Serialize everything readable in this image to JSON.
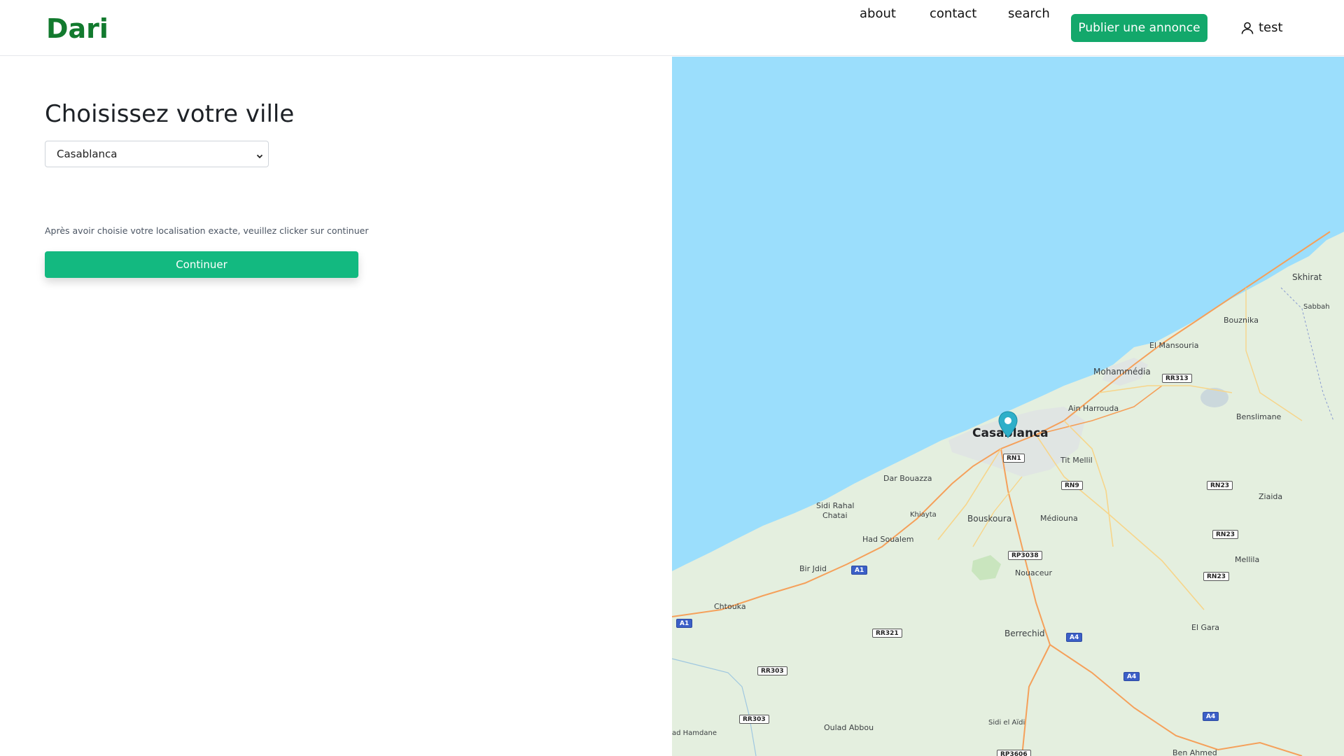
{
  "header": {
    "logo": "Dari",
    "nav": {
      "about": "about",
      "contact": "contact",
      "search": "search"
    },
    "publish_label": "Publier une annonce",
    "user_label": "test"
  },
  "main": {
    "title": "Choisissez votre ville",
    "city_select": {
      "selected": "Casablanca"
    },
    "hint": "Après avoir choisie votre localisation exacte, veuillez clicker sur continuer",
    "continue_label": "Continuer"
  },
  "map": {
    "colors": {
      "water": "#9bdefc",
      "land": "#e4efdf",
      "road_major": "#f5a05a",
      "road_minor": "#f7d58a",
      "urban": "#dfe3e3",
      "marker": "#2eafc9"
    },
    "marker_icon": "map-pin-icon",
    "labels": {
      "casablanca": "Casablanca",
      "skhirat": "Skhirat",
      "sabbah": "Sabbah",
      "bouznika": "Bouznika",
      "el_mansouria": "El Mansouria",
      "mohammedia": "Mohammédia",
      "ain_harrouda": "Ain Harrouda",
      "benslimane": "Benslimane",
      "tit_mellil": "Tit Mellil",
      "dar_bouazza": "Dar Bouazza",
      "sidi_rahal": "Sidi Rahal",
      "chatai": "Chatai",
      "khiayta": "Khiayta",
      "bouskoura": "Bouskoura",
      "mediouna": "Médiouna",
      "ziaida": "Ziaida",
      "had_soualem": "Had Soualem",
      "bir_jdid": "Bir Jdid",
      "nouaceur": "Nouaceur",
      "mellila": "Mellila",
      "chtouka": "Chtouka",
      "berrechid": "Berrechid",
      "el_gara": "El Gara",
      "oulad_abbou": "Oulad Abbou",
      "sidi_el_aidi": "Sidi el Aïdi",
      "ad_hamdane": "ad Hamdane",
      "ben_ahmed": "Ben Ahmed"
    },
    "shields": {
      "rr313": "RR313",
      "rn1": "RN1",
      "rn9": "RN9",
      "rn23a": "RN23",
      "rn23b": "RN23",
      "rn23c": "RN23",
      "rp3038": "RP3038",
      "a1a": "A1",
      "a1b": "A1",
      "rr321": "RR321",
      "a4a": "A4",
      "a4b": "A4",
      "a4c": "A4",
      "rr303a": "RR303",
      "rr303b": "RR303",
      "rp3606": "RP3606"
    }
  }
}
